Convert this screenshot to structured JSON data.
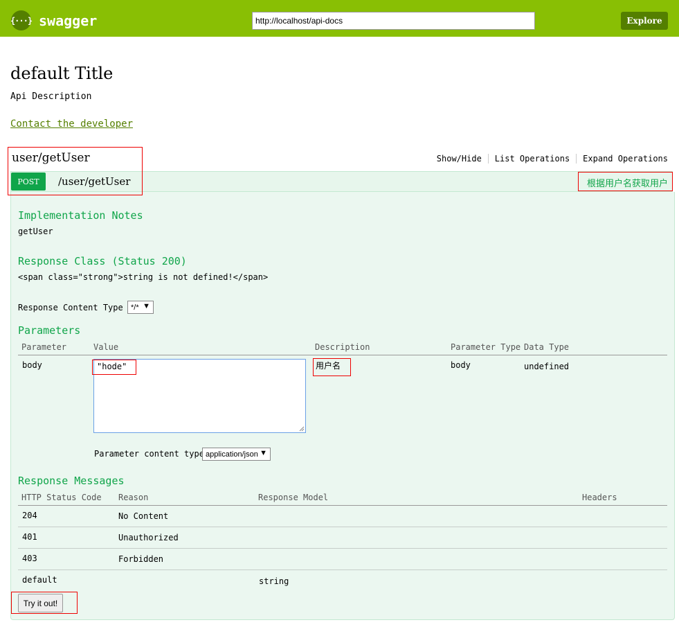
{
  "header": {
    "logo_icon_glyph": "{···}",
    "logo_text": "swagger",
    "url_value": "http://localhost/api-docs",
    "explore_label": "Explore",
    "brand_color": "#89bf04"
  },
  "info": {
    "title": "default Title",
    "description": "Api Description",
    "contact_label": "Contact the developer"
  },
  "resource": {
    "name": "user/getUser",
    "actions": [
      "Show/Hide",
      "List Operations",
      "Expand Operations"
    ]
  },
  "operation": {
    "method": "POST",
    "path": "/user/getUser",
    "summary": "根据用户名获取用户",
    "method_color": "#10a54a",
    "implementation_notes_heading": "Implementation Notes",
    "implementation_notes": "getUser",
    "response_class_heading": "Response Class (Status 200)",
    "response_class_body": "<span class=\"strong\">string is not defined!</span>",
    "response_content_type_label": "Response Content Type",
    "response_content_type_value": "*/*",
    "parameters_heading": "Parameters",
    "parameter_columns": [
      "Parameter",
      "Value",
      "Description",
      "Parameter Type",
      "Data Type"
    ],
    "parameters": [
      {
        "name": "body",
        "value": "\"hode\"",
        "description": "用户名",
        "param_type": "body",
        "data_type": "undefined"
      }
    ],
    "parameter_content_type_label": "Parameter content type:",
    "parameter_content_type_value": "application/json",
    "response_messages_heading": "Response Messages",
    "response_columns": [
      "HTTP Status Code",
      "Reason",
      "Response Model",
      "Headers"
    ],
    "response_messages": [
      {
        "code": "204",
        "reason": "No Content",
        "model": ""
      },
      {
        "code": "401",
        "reason": "Unauthorized",
        "model": ""
      },
      {
        "code": "403",
        "reason": "Forbidden",
        "model": ""
      },
      {
        "code": "default",
        "reason": "",
        "model": "string"
      }
    ],
    "try_label": "Try it out!"
  }
}
